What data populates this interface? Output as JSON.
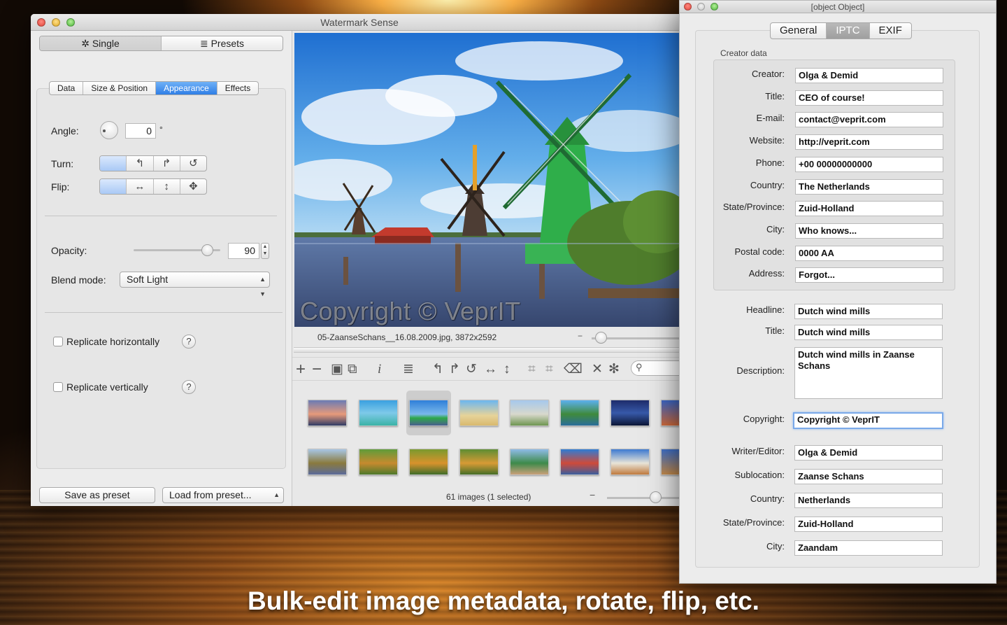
{
  "caption": "Bulk-edit image metadata, rotate, flip, etc.",
  "main_window": {
    "title": "Watermark Sense",
    "top_tabs": [
      {
        "label": "Single",
        "icon": "gear-icon"
      },
      {
        "label": "Presets",
        "icon": "list-icon"
      }
    ],
    "sub_tabs": [
      "Data",
      "Size & Position",
      "Appearance",
      "Effects"
    ],
    "active_sub_tab": "Appearance",
    "angle": {
      "label": "Angle:",
      "value": "0",
      "unit": "°"
    },
    "turn": {
      "label": "Turn:",
      "buttons": [
        "rotate-left-icon",
        "rotate-right-icon",
        "rotate-180-icon"
      ]
    },
    "flip": {
      "label": "Flip:",
      "buttons": [
        "flip-horizontal-icon",
        "flip-vertical-icon",
        "flip-both-icon"
      ]
    },
    "opacity": {
      "label": "Opacity:",
      "value": "90",
      "slider_fraction": 0.9
    },
    "blend_mode": {
      "label": "Blend mode:",
      "value": "Soft Light"
    },
    "replicate_h": {
      "label": "Replicate horizontally",
      "checked": false
    },
    "replicate_v": {
      "label": "Replicate vertically",
      "checked": false
    },
    "help": "?",
    "save_preset": "Save as preset",
    "load_preset": "Load from preset...",
    "preview_watermark": "Copyright © VeprIT",
    "file_info": "05-ZaanseSchans__16.08.2009.jpg,  3872x2592",
    "status": "61 images (1 selected)",
    "toolbar_icons": [
      "add-icon",
      "remove-icon",
      "save-icon",
      "save-all-icon",
      "info-icon",
      "list-icon",
      "rotate-left-icon",
      "rotate-right-icon",
      "rotate-180-icon",
      "flip-horizontal-icon",
      "flip-vertical-icon",
      "crop-icon",
      "crop-all-icon",
      "clear-icon",
      "close-icon",
      "close-all-icon",
      "search-icon"
    ],
    "search_placeholder": ""
  },
  "meta_window": {
    "title": {
      "label": "Title:",
      "value": "Dutch wind mills"
    },
    "tabs": [
      "General",
      "IPTC",
      "EXIF"
    ],
    "active_tab": "IPTC",
    "creator_section": "Creator data",
    "creator_fields": [
      {
        "label": "Creator:",
        "value": "Olga & Demid"
      },
      {
        "label": "Title:",
        "value": "CEO of course!"
      },
      {
        "label": "E-mail:",
        "value": "contact@veprit.com"
      },
      {
        "label": "Website:",
        "value": "http://veprit.com"
      },
      {
        "label": "Phone:",
        "value": "+00 00000000000"
      },
      {
        "label": "Country:",
        "value": "The Netherlands"
      },
      {
        "label": "State/Province:",
        "value": "Zuid-Holland"
      },
      {
        "label": "City:",
        "value": "Who knows..."
      },
      {
        "label": "Postal code:",
        "value": "0000 AA"
      },
      {
        "label": "Address:",
        "value": "Forgot..."
      }
    ],
    "headline": {
      "label": "Headline:",
      "value": "Dutch wind mills"
    },
    "description": {
      "label": "Description:",
      "value": "Dutch wind mills in Zaanse Schans"
    },
    "copyright": {
      "label": "Copyright:",
      "value": "Copyright © VeprIT"
    },
    "writer": {
      "label": "Writer/Editor:",
      "value": "Olga & Demid"
    },
    "sublocation": {
      "label": "Sublocation:",
      "value": "Zaanse Schans"
    },
    "country": {
      "label": "Country:",
      "value": "Netherlands"
    },
    "state": {
      "label": "State/Province:",
      "value": "Zuid-Holland"
    },
    "city": {
      "label": "City:",
      "value": "Zaandam"
    }
  }
}
